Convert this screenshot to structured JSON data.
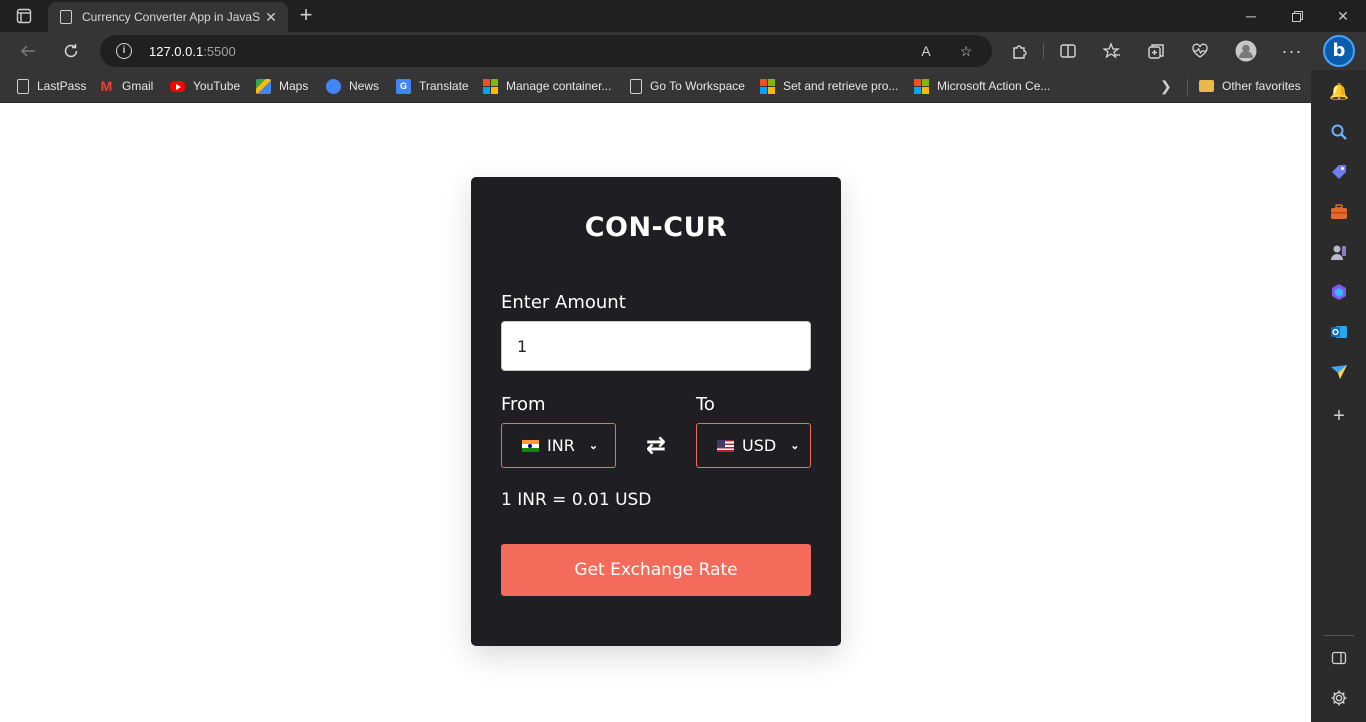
{
  "browser": {
    "tab_title": "Currency Converter App in JavaS",
    "url_host": "127.0.0.1",
    "url_port": ":5500",
    "colors": {
      "frame": "#202020",
      "toolbar": "#353535",
      "accent_bing": "#0b5cad"
    }
  },
  "favorites": [
    {
      "label": "LastPass",
      "icon": "document-icon"
    },
    {
      "label": "Gmail",
      "icon": "gmail-icon"
    },
    {
      "label": "YouTube",
      "icon": "youtube-icon"
    },
    {
      "label": "Maps",
      "icon": "maps-icon"
    },
    {
      "label": "News",
      "icon": "news-icon"
    },
    {
      "label": "Translate",
      "icon": "translate-icon"
    },
    {
      "label": "Manage container...",
      "icon": "microsoft-icon"
    },
    {
      "label": "Go To Workspace",
      "icon": "document-icon"
    },
    {
      "label": "Set and retrieve pro...",
      "icon": "microsoft-icon"
    },
    {
      "label": "Microsoft Action Ce...",
      "icon": "microsoft-icon"
    }
  ],
  "other_favorites_label": "Other favorites",
  "app": {
    "title": "CON-CUR",
    "amount_label": "Enter Amount",
    "amount_value": "1",
    "from_label": "From",
    "to_label": "To",
    "from_currency": "INR",
    "to_currency": "USD",
    "rate_message": "1 INR = 0.01 USD",
    "button_label": "Get Exchange Rate",
    "colors": {
      "card": "#1f1f23",
      "accent": "#f46b5b",
      "text": "#ffffff"
    }
  }
}
